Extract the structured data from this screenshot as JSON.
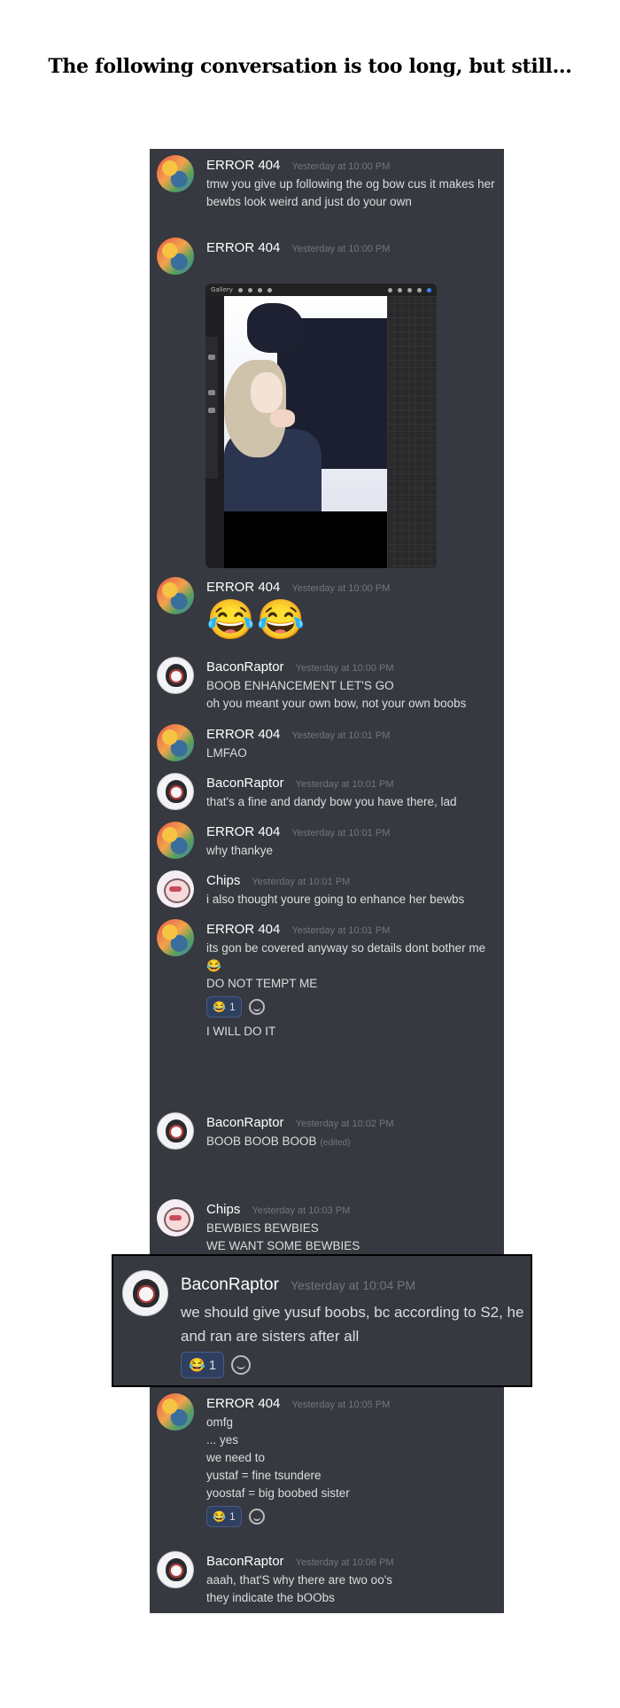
{
  "caption": "The following conversation is too long, but still...",
  "messages": [
    {
      "author": "ERROR 404",
      "ts": "Yesterday at 10:00 PM",
      "lines": [
        "tmw you give up following the og bow cus it makes her bewbs look weird and just do your own"
      ]
    },
    {
      "author": "ERROR 404",
      "ts": "Yesterday at 10:00 PM",
      "attachment_toolbar_label": "Gallery"
    },
    {
      "author": "ERROR 404",
      "ts": "Yesterday at 10:00 PM",
      "emoji": "😂😂"
    },
    {
      "author": "BaconRaptor",
      "ts": "Yesterday at 10:00 PM",
      "lines": [
        "BOOB ENHANCEMENT LET'S GO",
        "oh you meant your own bow, not your own boobs"
      ]
    },
    {
      "author": "ERROR 404",
      "ts": "Yesterday at 10:01 PM",
      "lines": [
        "LMFAO"
      ]
    },
    {
      "author": "BaconRaptor",
      "ts": "Yesterday at 10:01 PM",
      "lines": [
        "that's a fine and dandy bow you have there, lad"
      ]
    },
    {
      "author": "ERROR 404",
      "ts": "Yesterday at 10:01 PM",
      "lines": [
        "why thankye"
      ]
    },
    {
      "author": "Chips",
      "ts": "Yesterday at 10:01 PM",
      "lines": [
        "i also thought youre going to enhance her bewbs"
      ]
    },
    {
      "author": "ERROR 404",
      "ts": "Yesterday at 10:01 PM",
      "lines": [
        "its  gon be covered anyway so details dont bother me😂",
        "DO NOT TEMPT ME",
        "I WILL DO IT"
      ],
      "reaction": {
        "emoji": "😂",
        "count": "1"
      }
    },
    {
      "author": "BaconRaptor",
      "ts": "Yesterday at 10:02 PM",
      "lines": [
        "BOOB BOOB BOOB"
      ],
      "edited": "(edited)"
    },
    {
      "author": "Chips",
      "ts": "Yesterday at 10:03 PM",
      "lines": [
        "BEWBIES BEWBIES",
        "WE WANT SOME BEWBIES"
      ]
    },
    {
      "author": "BaconRaptor",
      "ts": "Yesterday at 10:04 PM",
      "lines": [
        "we should give yusuf boobs, bc according to S2, he and ran are sisters after all"
      ],
      "reaction": {
        "emoji": "😂",
        "count": "1"
      }
    },
    {
      "author": "ERROR 404",
      "ts": "Yesterday at 10:05 PM",
      "lines": [
        "omfg",
        "... yes",
        "we need to",
        "yustaf = fine tsundere",
        "yoostaf = big boobed sister"
      ],
      "reaction": {
        "emoji": "😂",
        "count": "1"
      }
    },
    {
      "author": "BaconRaptor",
      "ts": "Yesterday at 10:06 PM",
      "lines": [
        "aaah, that'S why there are two oo's",
        "they indicate the bOObs"
      ]
    }
  ]
}
